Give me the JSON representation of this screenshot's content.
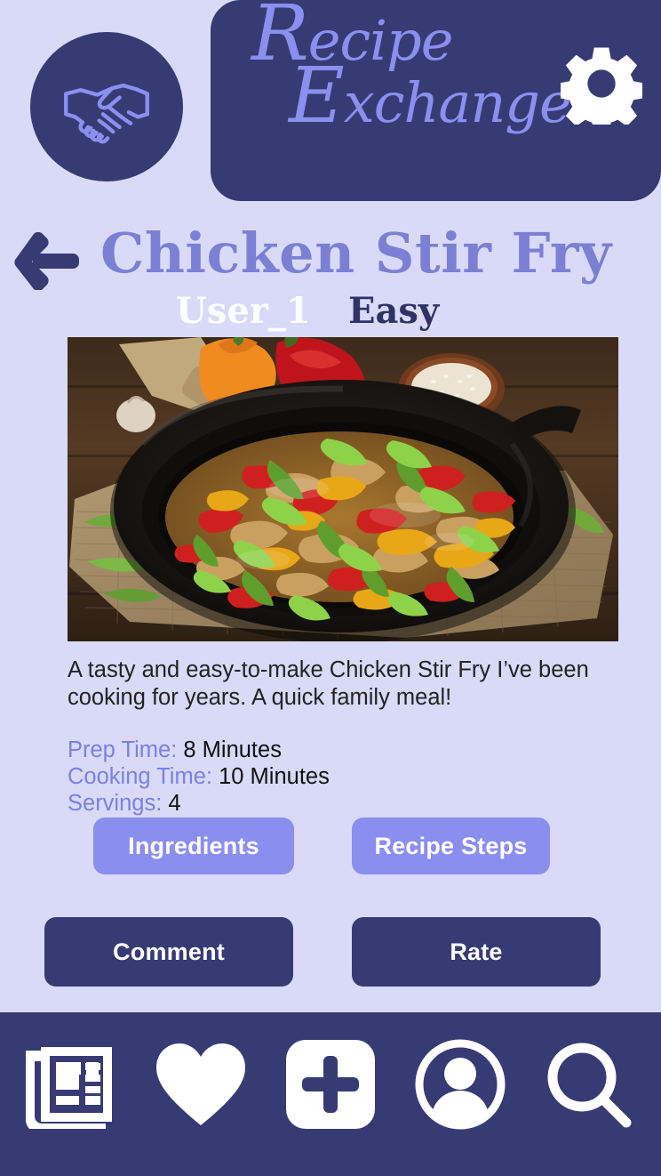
{
  "app": {
    "brand_line1": "Recipe",
    "brand_line2": "Exchange",
    "brand_line1_cap": "R",
    "brand_line1_rest": "ecipe",
    "brand_line2_cap": "E",
    "brand_line2_rest": "xchange",
    "logo_icon": "handshake-icon",
    "settings_icon": "gear-icon",
    "accent_color": "#8b8ff0",
    "dark_color": "#373b73",
    "background_color": "#d8daf7"
  },
  "header": {
    "back_icon": "back-arrow-icon",
    "title": "Chicken Stir Fry",
    "author": "User_1",
    "difficulty": "Easy"
  },
  "recipe": {
    "photo_alt": "Chicken stir fry with bell peppers and green onions in a black cast iron skillet on burlap",
    "description": "A tasty and easy-to-make Chicken Stir Fry I’ve been cooking for years. A quick family meal!",
    "facts": [
      {
        "label": "Prep Time:",
        "value": "8 Minutes"
      },
      {
        "label": "Cooking Time:",
        "value": "10 Minutes"
      },
      {
        "label": "Servings:",
        "value": "4"
      }
    ]
  },
  "actions": {
    "ingredients": "Ingredients",
    "recipe_steps": "Recipe Steps",
    "comment": "Comment",
    "rate": "Rate"
  },
  "bottom_nav": {
    "items": [
      {
        "name": "feed",
        "icon": "newspaper-icon"
      },
      {
        "name": "favorites",
        "icon": "heart-icon"
      },
      {
        "name": "add",
        "icon": "plus-square-icon"
      },
      {
        "name": "profile",
        "icon": "person-circle-icon"
      },
      {
        "name": "search",
        "icon": "search-icon"
      }
    ]
  }
}
